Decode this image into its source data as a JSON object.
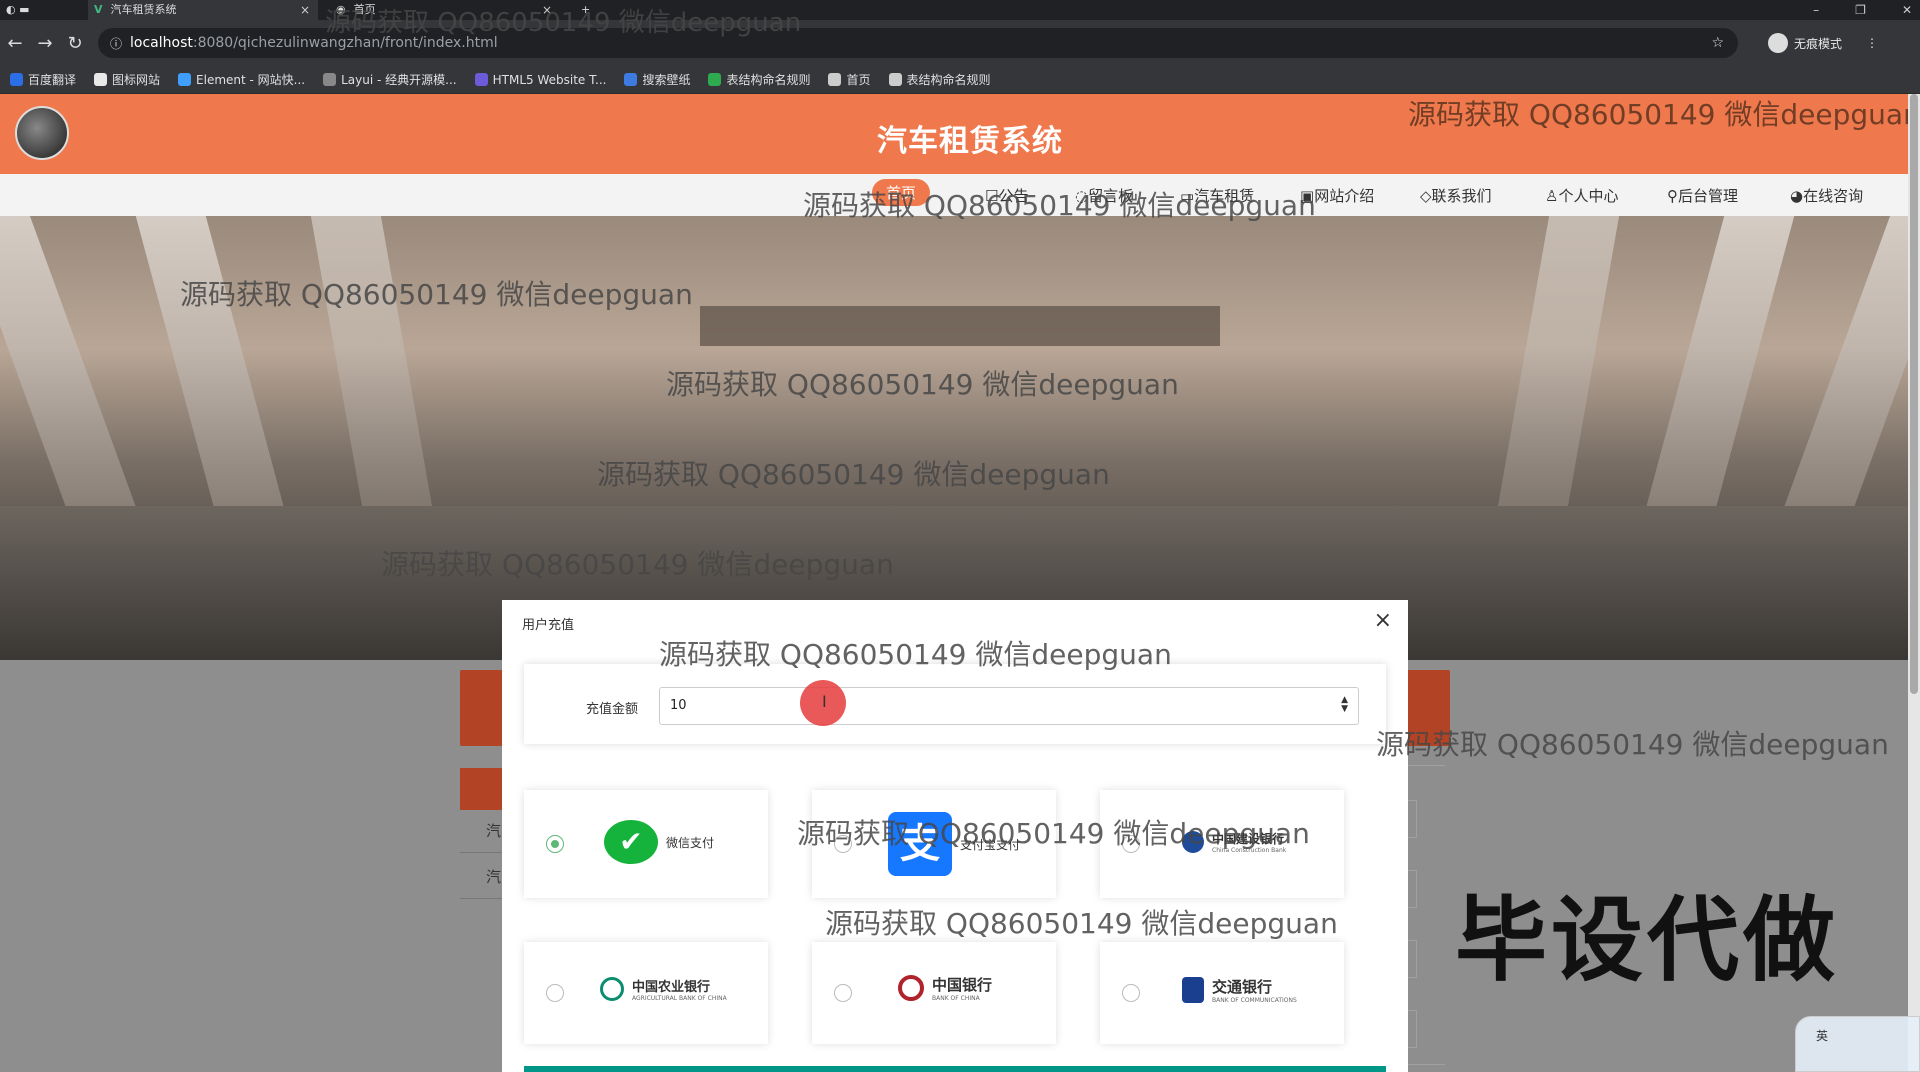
{
  "browser": {
    "tabs": [
      {
        "label": "汽车租赁系统",
        "close": "×"
      },
      {
        "label": "首页",
        "close": "×"
      }
    ],
    "new_tab": "+",
    "window_controls": [
      "–",
      "❐",
      "✕"
    ],
    "url_host": "localhost",
    "url_path": ":8080/qichezulinwangzhan/front/index.html",
    "incognito_label": "无痕模式",
    "bookmarks": [
      {
        "label": "百度翻译",
        "color": "#2a6ee8"
      },
      {
        "label": "图标网站",
        "color": "#e8e8e8"
      },
      {
        "label": "Element - 网站快...",
        "color": "#409eff"
      },
      {
        "label": "Layui - 经典开源模...",
        "color": "#888888"
      },
      {
        "label": "HTML5 Website T...",
        "color": "#6b5bd6"
      },
      {
        "label": "搜索壁纸",
        "color": "#3d7be0"
      },
      {
        "label": "表结构命名规则",
        "color": "#2eaa4f"
      },
      {
        "label": "首页",
        "color": "#cccccc"
      },
      {
        "label": "表结构命名规则",
        "color": "#cccccc"
      }
    ]
  },
  "site": {
    "title": "汽车租赁系统",
    "nav": [
      "首页",
      "公告",
      "留言板",
      "汽车租赁",
      "网站介绍",
      "联系我们",
      "个人中心",
      "后台管理",
      "在线咨询"
    ],
    "side_items": [
      "汽",
      "汽"
    ]
  },
  "modal": {
    "title": "用户充值",
    "close": "×",
    "amount_label": "充值金额",
    "amount_value": "10",
    "payment_options": [
      {
        "name": "微信支付",
        "selected": true
      },
      {
        "name": "支付宝支付",
        "selected": false
      },
      {
        "name": "中国建设银行",
        "en": "China Construction Bank",
        "selected": false
      },
      {
        "name": "中国农业银行",
        "en": "AGRICULTURAL BANK OF CHINA",
        "selected": false
      },
      {
        "name": "中国银行",
        "en": "BANK OF CHINA",
        "selected": false
      },
      {
        "name": "交通银行",
        "en": "BANK OF COMMUNICATIONS",
        "selected": false
      }
    ]
  },
  "overlay": {
    "watermark": "源码获取 QQ86050149 微信deepguan",
    "promo": "毕设代做",
    "ime_label": "英"
  }
}
